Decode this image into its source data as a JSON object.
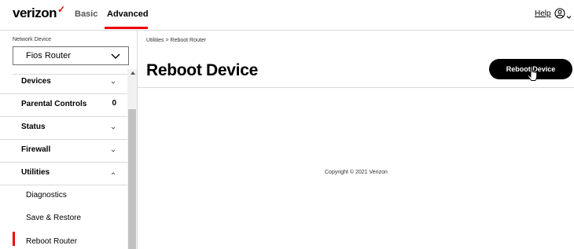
{
  "header": {
    "logo_text": "verizon",
    "logo_check": "✓",
    "tabs": [
      {
        "label": "Basic"
      },
      {
        "label": "Advanced"
      }
    ],
    "help_label": "Help",
    "user_icon": "user-icon"
  },
  "sidebar": {
    "network_device_label": "Network Device",
    "network_device_value": "Fios Router",
    "menu": [
      {
        "label": "Devices",
        "state": "collapsed"
      },
      {
        "label": "Parental Controls",
        "count": "0"
      },
      {
        "label": "Status",
        "state": "collapsed"
      },
      {
        "label": "Firewall",
        "state": "collapsed"
      },
      {
        "label": "Utilities",
        "state": "expanded"
      }
    ],
    "submenu": [
      {
        "label": "Diagnostics"
      },
      {
        "label": "Save & Restore"
      },
      {
        "label": "Reboot Router",
        "active": true
      }
    ]
  },
  "main": {
    "breadcrumb": "Utilities  >  Reboot Router",
    "title": "Reboot Device",
    "reboot_button_label": "Reboot Device",
    "copyright": "Copyright © 2021 Verizon"
  },
  "colors": {
    "brand_red": "#ee0000",
    "button_bg": "#000000",
    "divider": "#d8dada"
  }
}
